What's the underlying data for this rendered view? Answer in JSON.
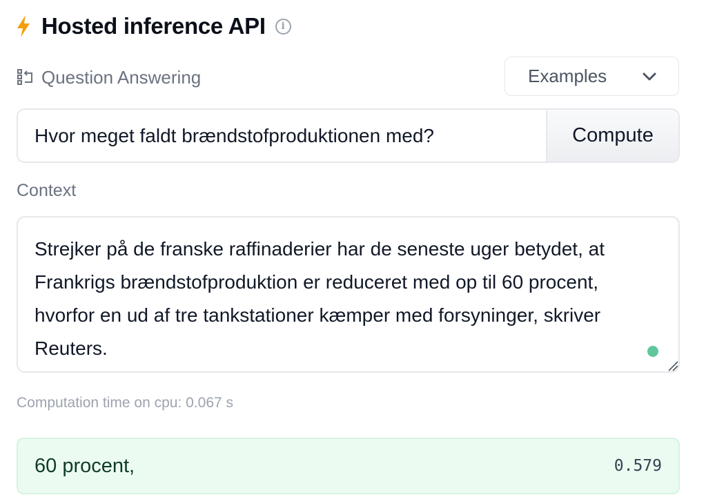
{
  "header": {
    "title": "Hosted inference API",
    "info_glyph": "i",
    "bolt_color": "#f59e0b"
  },
  "task": {
    "label": "Question Answering"
  },
  "examples": {
    "label": "Examples"
  },
  "question": {
    "value": "Hvor meget faldt brændstofproduktionen med?"
  },
  "compute_button": {
    "label": "Compute"
  },
  "context": {
    "label": "Context",
    "text": "Strejker på de franske raffinaderier har de seneste uger betydet, at Frankrigs brændstofproduktion er reduceret med op til 60 procent, hvorfor en ud af tre tankstationer kæmper med forsyninger, skriver Reuters."
  },
  "computation": {
    "text": "Computation time on cpu: 0.067 s"
  },
  "answer": {
    "text": "60 procent,",
    "score": "0.579"
  }
}
